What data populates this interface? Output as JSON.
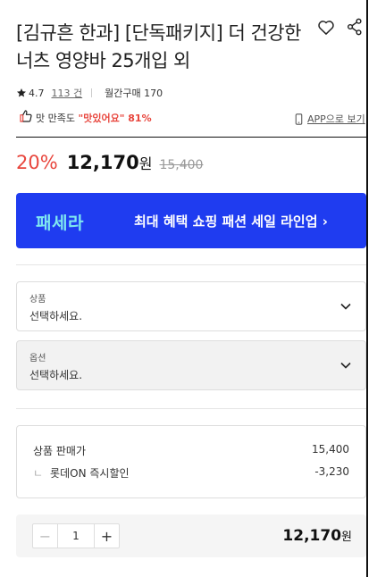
{
  "product": {
    "title": "[김규흔 한과] [단독패키지] 더 건강한 너츠 영양바 25개입 외"
  },
  "rating": {
    "score": "4.7",
    "review_count": "113 건",
    "monthly_purchase": "월간구매 170"
  },
  "satisfaction": {
    "label": "맛 만족도",
    "quote": "\"맛있어요\" 81%",
    "app_link": "APP으로 보기"
  },
  "price": {
    "discount_rate": "20%",
    "sale_price": "12,170",
    "currency": "원",
    "original_price": "15,400"
  },
  "banner": {
    "logo": "패세라",
    "text": "최대 혜택 쇼핑 패션 세일 라인업 ›"
  },
  "options": {
    "product_select": {
      "label": "상품",
      "value": "선택하세요."
    },
    "option_select": {
      "label": "옵션",
      "value": "선택하세요."
    }
  },
  "summary": {
    "price_label": "상품 판매가",
    "price_value": "15,400",
    "discount_mark": "ㄴ",
    "discount_label": "롯데ON 즉시할인",
    "discount_value": "-3,230"
  },
  "quantity": {
    "minus": "−",
    "value": "1",
    "plus": "+",
    "total": "12,170",
    "currency": "원"
  },
  "colors": {
    "accent_red": "#e8463d",
    "banner_blue": "#1f3cf0",
    "banner_logo": "#7fe7f0"
  },
  "icons": [
    "heart-icon",
    "share-icon",
    "star-icon",
    "thumbs-up-icon",
    "phone-icon",
    "chevron-down-icon"
  ]
}
